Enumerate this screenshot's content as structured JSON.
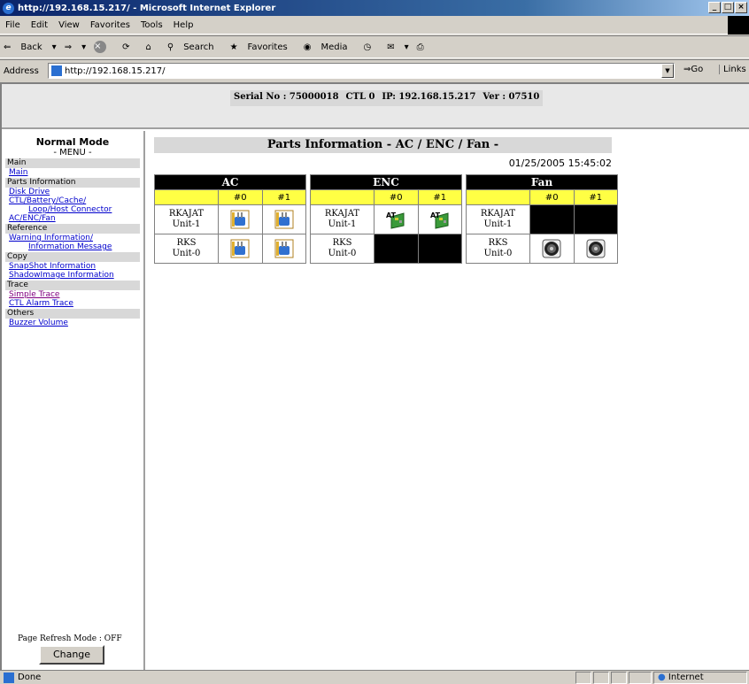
{
  "window": {
    "title": "http://192.168.15.217/ - Microsoft Internet Explorer",
    "min": "_",
    "max": "□",
    "close": "×"
  },
  "menubar": [
    "File",
    "Edit",
    "View",
    "Favorites",
    "Tools",
    "Help"
  ],
  "toolbar": {
    "back": "Back",
    "search": "Search",
    "favorites": "Favorites",
    "media": "Media"
  },
  "address": {
    "label": "Address",
    "url": "http://192.168.15.217/",
    "go": "Go",
    "links": "Links"
  },
  "header": {
    "serial": "Serial No : 75000018",
    "ctl": "CTL 0",
    "ip": "IP: 192.168.15.217",
    "ver": "Ver : 07510"
  },
  "sidebar": {
    "mode": "Normal Mode",
    "menu": "- MENU -",
    "sections": [
      {
        "title": "Main",
        "links": [
          "Main"
        ]
      },
      {
        "title": "Parts Information",
        "links": [
          "Disk Drive",
          "CTL/Battery/Cache/",
          "Loop/Host Connector",
          "AC/ENC/Fan"
        ]
      },
      {
        "title": "Reference",
        "links": [
          "Warning Information/",
          "Information Message"
        ]
      },
      {
        "title": "Copy",
        "links": [
          "SnapShot Information",
          "ShadowImage Information"
        ]
      },
      {
        "title": "Trace",
        "links": [
          "Simple Trace",
          "CTL Alarm Trace"
        ]
      },
      {
        "title": "Others",
        "links": [
          "Buzzer Volume"
        ]
      }
    ],
    "refresh_label": "Page Refresh Mode : OFF",
    "change_button": "Change"
  },
  "page": {
    "title": "Parts Information - AC / ENC / Fan -",
    "datetime": "01/25/2005 15:45:02"
  },
  "tables": [
    {
      "name": "AC",
      "cols": [
        "#0",
        "#1"
      ],
      "rows": [
        {
          "unit": "RKAJAT",
          "sub": "Unit-1",
          "cells": [
            "plug-icon",
            "plug-icon"
          ]
        },
        {
          "unit": "RKS",
          "sub": "Unit-0",
          "cells": [
            "plug-icon",
            "plug-icon"
          ]
        }
      ]
    },
    {
      "name": "ENC",
      "cols": [
        "#0",
        "#1"
      ],
      "rows": [
        {
          "unit": "RKAJAT",
          "sub": "Unit-1",
          "cells": [
            "enc-board-icon",
            "enc-board-icon"
          ]
        },
        {
          "unit": "RKS",
          "sub": "Unit-0",
          "cells": [
            "empty",
            "empty"
          ]
        }
      ]
    },
    {
      "name": "Fan",
      "cols": [
        "#0",
        "#1"
      ],
      "rows": [
        {
          "unit": "RKAJAT",
          "sub": "Unit-1",
          "cells": [
            "empty",
            "empty"
          ]
        },
        {
          "unit": "RKS",
          "sub": "Unit-0",
          "cells": [
            "fan-icon",
            "fan-icon"
          ]
        }
      ]
    }
  ],
  "status": {
    "text": "Done",
    "zone": "Internet"
  }
}
